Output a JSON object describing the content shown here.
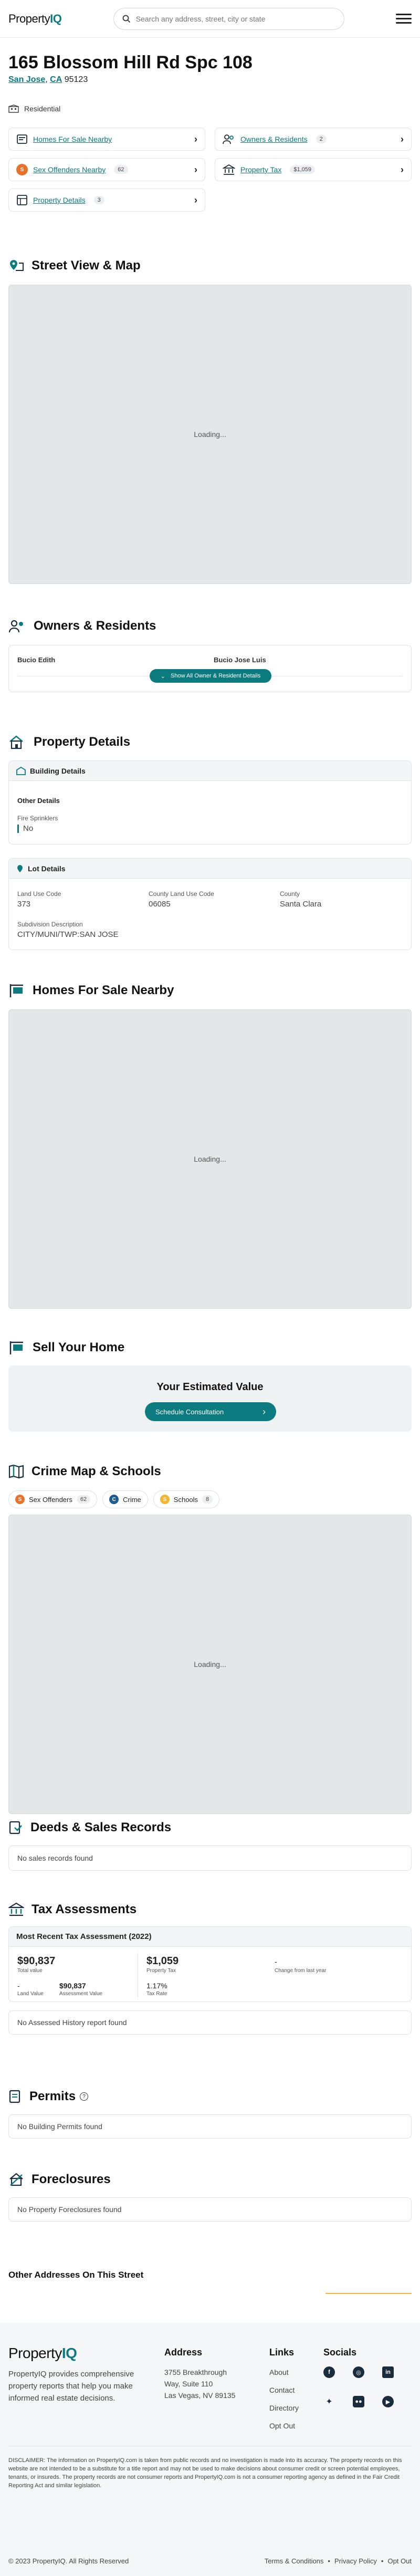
{
  "header": {
    "logo_left": "Property",
    "logo_right": "IQ",
    "search_placeholder": "Search any address, street, city or state"
  },
  "property": {
    "title": "165 Blossom Hill Rd Spc 108",
    "city": "San Jose",
    "state": "CA",
    "zip": "95123",
    "type": "Residential"
  },
  "quick_links": [
    {
      "label": "Homes For Sale Nearby",
      "badge": ""
    },
    {
      "label": "Owners & Residents",
      "badge": "2"
    },
    {
      "label": "Sex Offenders Nearby",
      "badge": "62"
    },
    {
      "label": "Property Tax",
      "badge": "$1,059"
    },
    {
      "label": "Property Details",
      "badge": "3"
    }
  ],
  "street_view": {
    "title": "Street View & Map",
    "loading": "Loading..."
  },
  "owners": {
    "title": "Owners & Residents",
    "names": [
      "Bucio Edith",
      "Bucio Jose Luis"
    ],
    "button": "Show All Owner & Resident Details"
  },
  "details": {
    "title": "Property Details",
    "building": {
      "header": "Building Details",
      "group": "Other Details",
      "label": "Fire Sprinklers",
      "value": "No"
    },
    "lot": {
      "header": "Lot Details",
      "fields": [
        {
          "label": "Land Use Code",
          "value": "373"
        },
        {
          "label": "County Land Use Code",
          "value": "06085"
        },
        {
          "label": "County",
          "value": "Santa Clara"
        }
      ],
      "subdivision_label": "Subdivision Description",
      "subdivision_value": "CITY/MUNI/TWP:SAN JOSE"
    }
  },
  "homes_sale": {
    "title": "Homes For Sale Nearby",
    "loading": "Loading..."
  },
  "sell": {
    "title": "Sell Your Home",
    "subtitle": "Your Estimated Value",
    "button": "Schedule Consultation"
  },
  "crime": {
    "title": "Crime Map & Schools",
    "pills": [
      {
        "label": "Sex Offenders",
        "badge": "62",
        "color": "#e8722a",
        "glyph": "S"
      },
      {
        "label": "Crime",
        "badge": "",
        "color": "#1f5d8c",
        "glyph": "C"
      },
      {
        "label": "Schools",
        "badge": "8",
        "color": "#f2b632",
        "glyph": "S"
      }
    ],
    "loading": "Loading..."
  },
  "deeds": {
    "title": "Deeds & Sales Records",
    "empty": "No sales records found"
  },
  "tax": {
    "title": "Tax Assessments",
    "header": "Most Recent Tax Assessment (2022)",
    "total_value": "$90,837",
    "total_label": "Total value",
    "land_value": "-",
    "land_label": "Land Value",
    "assess_value": "$90,837",
    "assess_label": "Assessment Value",
    "property_tax": "$1,059",
    "property_tax_label": "Property Tax",
    "tax_rate": "1.17%",
    "tax_rate_label": "Tax Rate",
    "change": "-",
    "change_label": "Change from last year",
    "history_empty": "No Assessed History report found"
  },
  "permits": {
    "title": "Permits",
    "empty": "No Building Permits found"
  },
  "foreclosures": {
    "title": "Foreclosures",
    "empty": "No Property Foreclosures found"
  },
  "other": {
    "title": "Other Addresses On This Street"
  },
  "footer": {
    "logo_left": "Property",
    "logo_right": "IQ",
    "blurb": "PropertyIQ provides comprehensive property reports that help you make informed real estate decisions.",
    "address_title": "Address",
    "address_lines": [
      "3755 Breakthrough",
      "Way, Suite 110",
      "Las Vegas, NV 89135"
    ],
    "links_title": "Links",
    "links": [
      "About",
      "Contact",
      "Directory",
      "Opt Out"
    ],
    "socials_title": "Socials",
    "disclaimer": "DISCLAIMER: The information on PropertyIQ.com is taken from public records and no investigation is made into its accuracy. The property records on this website are not intended to be a substitute for a title report and may not be used to make decisions about consumer credit or screen potential employees, tenants, or insureds. The property records are not consumer reports and PropertyIQ.com is not a consumer reporting agency as defined in the Fair Credit Reporting Act and similar legislation.",
    "copyright": "© 2023 PropertyIQ. All Rights Reserved",
    "bottom_links": [
      "Terms & Conditions",
      "Privacy Policy",
      "Opt Out"
    ],
    "separator": "•"
  }
}
